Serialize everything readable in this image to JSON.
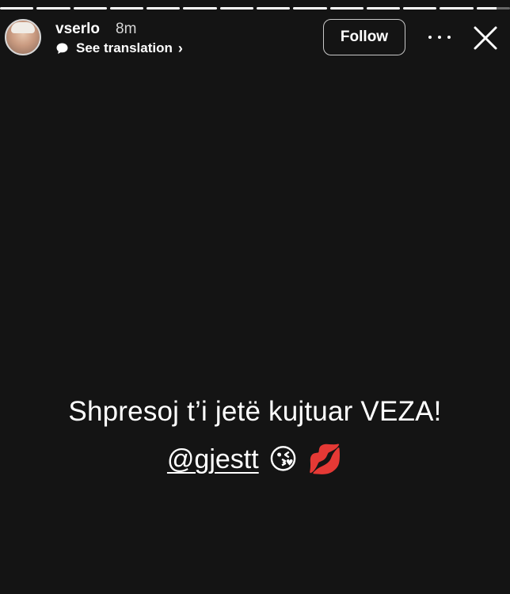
{
  "story": {
    "progress_segments": [
      1,
      1,
      1,
      1,
      1,
      1,
      1,
      1,
      1,
      1,
      1,
      1,
      1,
      0.6
    ],
    "user": {
      "username": "vserlo",
      "time_ago": "8m",
      "avatar_icon": "user-avatar"
    },
    "translation_label": "See translation",
    "follow_label": "Follow",
    "more_icon": "more-horizontal-icon",
    "close_icon": "close-icon",
    "caption_line1": "Shpresoj t’i jetë kujtuar VEZA!",
    "mention": "@gjestt",
    "emojis": [
      "😘",
      "💋"
    ],
    "colors": {
      "background": "#141414",
      "text": "#ffffff",
      "follow_border": "#c8c8c8"
    }
  }
}
